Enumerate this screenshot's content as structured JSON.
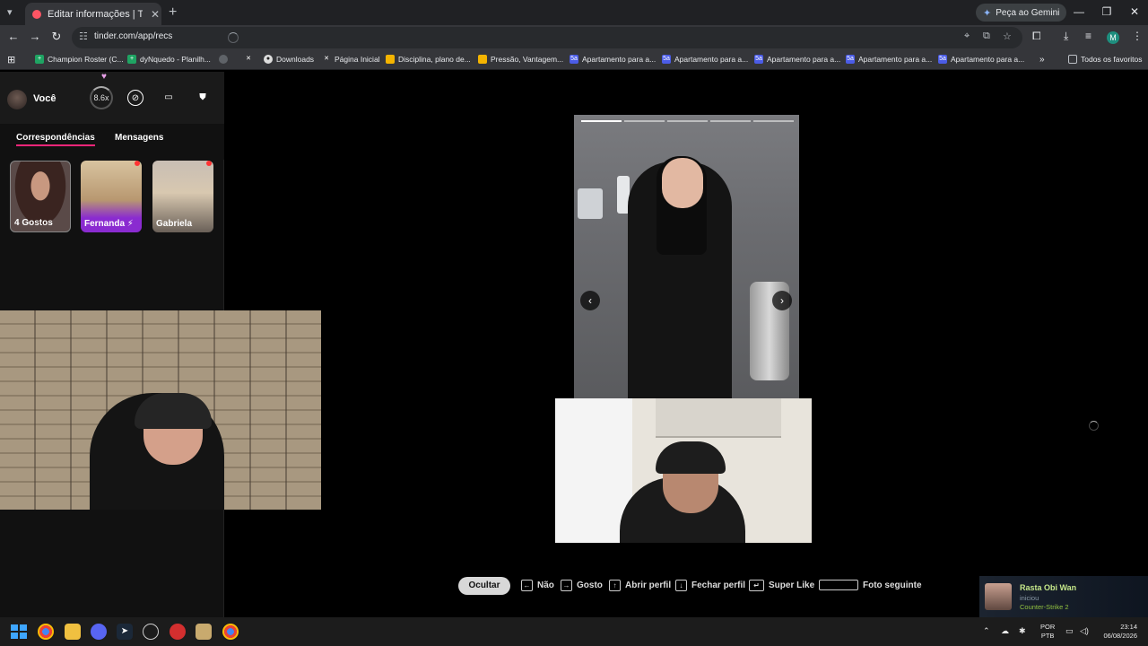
{
  "browser": {
    "tab_title": "Editar informações | Tinder",
    "new_tab": "+",
    "gemini_label": "Peça ao Gemini",
    "url": "tinder.com/app/recs",
    "bookmarks": [
      {
        "label": "Champion Roster (C...",
        "icon": "spreadsheet-icon",
        "color": "#1fa463"
      },
      {
        "label": "dyNquedo - Planilh...",
        "icon": "spreadsheet-icon",
        "color": "#1fa463"
      },
      {
        "label": "",
        "icon": "globe-icon",
        "color": "#5f6368"
      },
      {
        "label": "Downloads",
        "icon": "x-icon",
        "color": "#35363a"
      },
      {
        "label": "Página Inicial",
        "icon": "github-icon",
        "color": "#35363a"
      },
      {
        "label": "Página Inicial",
        "icon": "x-icon",
        "color": "#35363a"
      },
      {
        "label": "Disciplina, plano de...",
        "icon": "doc-icon",
        "color": "#f4b400"
      },
      {
        "label": "Pressão, Vantagem...",
        "icon": "doc-icon",
        "color": "#f4b400"
      },
      {
        "label": "Apartamento para a...",
        "icon": "5a-icon",
        "color": "#4b5ce6"
      },
      {
        "label": "Apartamento para a...",
        "icon": "5a-icon",
        "color": "#4b5ce6"
      },
      {
        "label": "Apartamento para a...",
        "icon": "5a-icon",
        "color": "#4b5ce6"
      },
      {
        "label": "Apartamento para a...",
        "icon": "5a-icon",
        "color": "#4b5ce6"
      },
      {
        "label": "Apartamento para a...",
        "icon": "5a-icon",
        "color": "#4b5ce6"
      }
    ],
    "more_bookmarks": "»",
    "all_favorites": "Todos os favoritos",
    "profile_initial": "M"
  },
  "sidebar": {
    "user_label": "Você",
    "score": "8.6x",
    "tabs": {
      "matches": "Correspondências",
      "messages": "Mensagens"
    },
    "matches": [
      {
        "label": "4 Gostos"
      },
      {
        "label": "Fernanda ⚡"
      },
      {
        "label": "Gabriela"
      }
    ]
  },
  "card": {
    "photo_count": 5,
    "prev_icon": "‹",
    "next_icon": "›"
  },
  "shortcuts": {
    "hide": "Ocultar",
    "no": "Não",
    "like": "Gosto",
    "open_profile": "Abrir perfil",
    "close_profile": "Fechar perfil",
    "super_like": "Super Like",
    "next_photo": "Foto seguinte"
  },
  "toast": {
    "name": "Rasta Obi Wan",
    "action": "iniciou",
    "game": "Counter-Strike 2"
  },
  "taskbar": {
    "lang_top": "POR",
    "lang_bottom": "PTB",
    "time": "23:14",
    "date": "06/08/2026"
  },
  "colors": {
    "accent": "#fd267a",
    "tinder": "#fd5564"
  }
}
